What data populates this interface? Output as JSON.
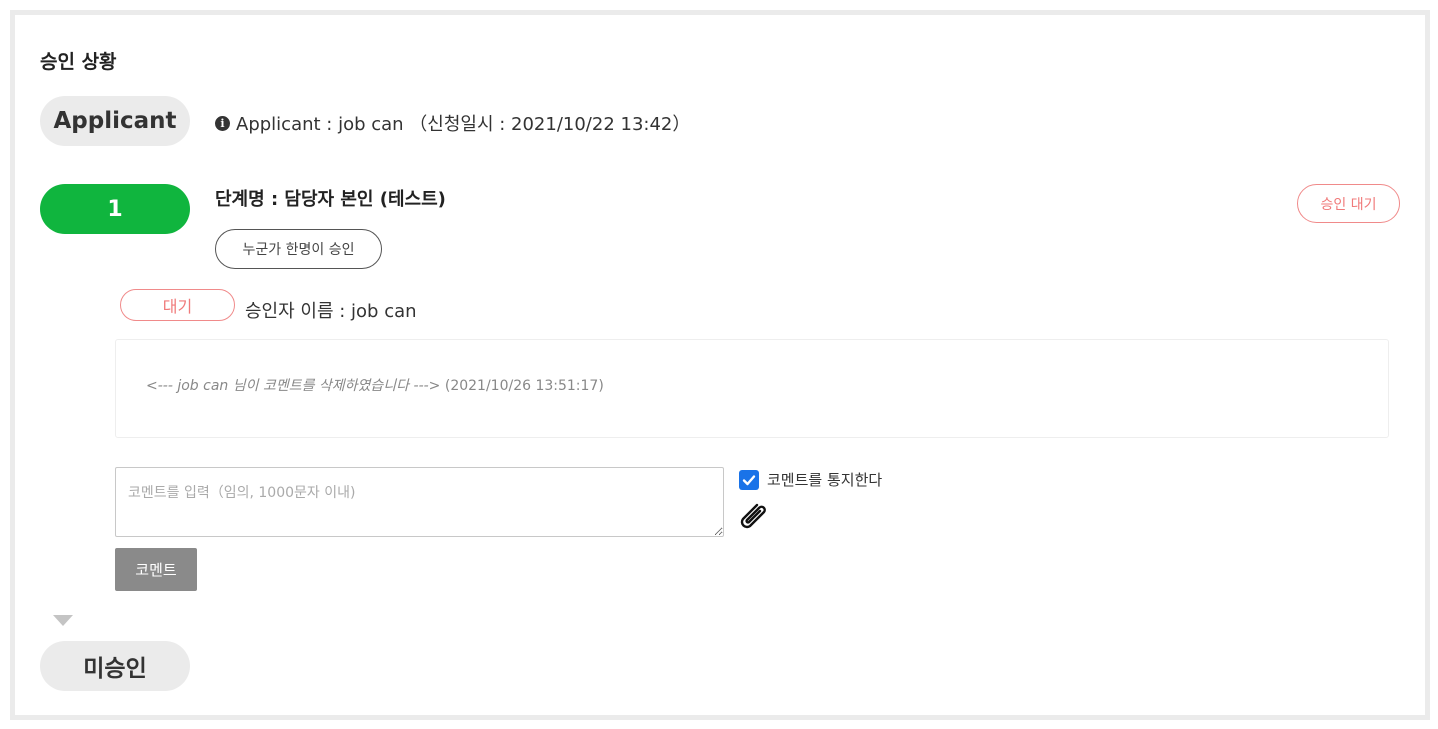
{
  "section_title": "승인 상황",
  "applicant": {
    "badge_label": "Applicant",
    "info_text": "Applicant : job can （신청일시 : 2021/10/22 13:42）"
  },
  "step": {
    "number": "1",
    "name": "단계명 : 담당자 본인 (테스트)",
    "rule_label": "누군가 한명이 승인",
    "status_label": "승인 대기"
  },
  "approver": {
    "status_label": "대기",
    "name_text": "승인자 이름 : job can"
  },
  "comment_log": {
    "deleted_message": "<--- job can 님이 코멘트를 삭제하였습니다 --->",
    "timestamp": "(2021/10/26 13:51:17)"
  },
  "comment_form": {
    "placeholder": "코멘트를 입력（임의, 1000문자 이내)",
    "value": "",
    "notify_label": "코멘트를 통지한다",
    "notify_checked": true,
    "submit_label": "코멘트"
  },
  "next_status": {
    "label": "미승인"
  },
  "colors": {
    "green": "#10b53e",
    "pending_red": "#f07a7a",
    "checkbox_blue": "#1a73e8"
  }
}
